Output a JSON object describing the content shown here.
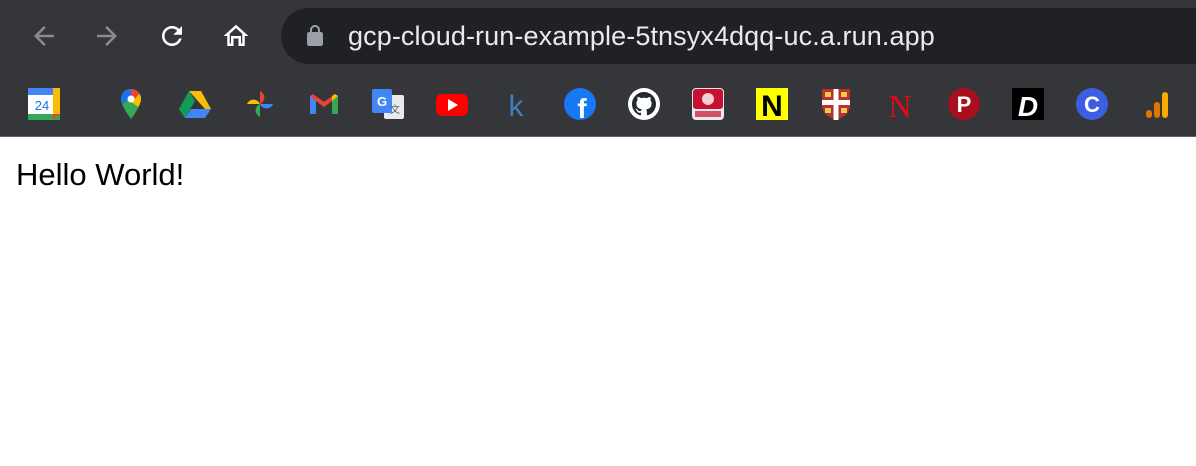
{
  "browser": {
    "toolbar": {
      "back_icon": "back-arrow-icon",
      "forward_icon": "forward-arrow-icon",
      "reload_icon": "reload-icon",
      "home_icon": "home-icon",
      "omnibox": {
        "url": "gcp-cloud-run-example-5tnsyx4dqq-uc.a.run.app",
        "security_icon": "lock-icon"
      }
    },
    "bookmarks": [
      {
        "icon": "google-calendar-icon",
        "text": "24"
      },
      {
        "icon": "google-maps-icon"
      },
      {
        "icon": "google-drive-icon"
      },
      {
        "icon": "google-photos-icon"
      },
      {
        "icon": "gmail-icon"
      },
      {
        "icon": "google-translate-icon"
      },
      {
        "icon": "youtube-icon"
      },
      {
        "icon": "k-site-icon",
        "text": "k"
      },
      {
        "icon": "facebook-icon",
        "text": "f"
      },
      {
        "icon": "github-icon"
      },
      {
        "icon": "news-site-icon"
      },
      {
        "icon": "n-site-icon",
        "text": "N"
      },
      {
        "icon": "crest-site-icon"
      },
      {
        "icon": "netflix-icon",
        "text": "N"
      },
      {
        "icon": "p-site-icon",
        "text": "P"
      },
      {
        "icon": "d-site-icon",
        "text": "D"
      },
      {
        "icon": "c-site-icon",
        "text": "C"
      },
      {
        "icon": "analytics-icon"
      }
    ],
    "colors": {
      "chrome_bg": "#35363a",
      "omnibox_bg": "#202124",
      "url_text": "#e8eaed"
    }
  },
  "page": {
    "text": "Hello World!"
  }
}
